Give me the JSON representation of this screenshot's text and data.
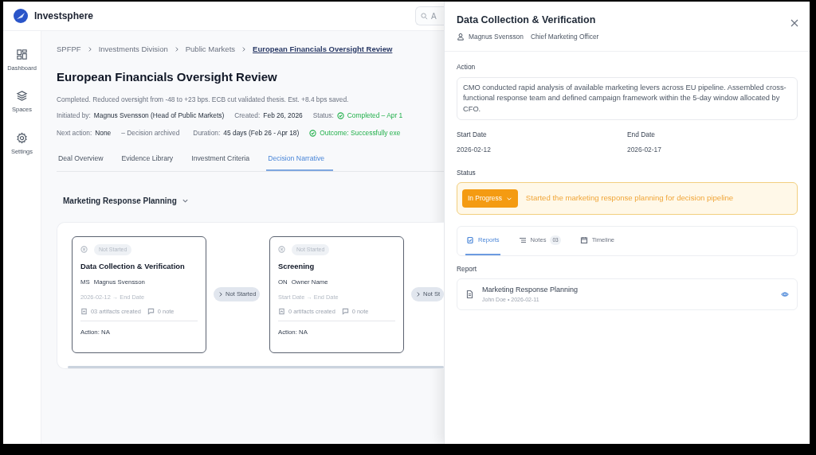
{
  "app": {
    "name": "Investsphere",
    "search_placeholder": "A"
  },
  "sidebar": {
    "items": [
      {
        "label": "Dashboard"
      },
      {
        "label": "Spaces"
      },
      {
        "label": "Settings"
      }
    ]
  },
  "breadcrumb": [
    {
      "label": "SPFPF",
      "current": false
    },
    {
      "label": "Investments Division",
      "current": false
    },
    {
      "label": "Public Markets",
      "current": false
    },
    {
      "label": "European Financials Oversight Review",
      "current": true
    }
  ],
  "page": {
    "title": "European Financials Oversight Review",
    "summary": "Completed. Reduced oversight from -48 to +23 bps. ECB cut validated thesis. Est. +8.4 bps saved.",
    "meta_rows": [
      [
        {
          "kind": "field",
          "label": "Initiated by:",
          "value": "Magnus Svensson (Head of Public Markets)"
        },
        {
          "kind": "field",
          "label": "Created:",
          "value": "Feb 26, 2026"
        },
        {
          "kind": "status",
          "label": "Status:",
          "value": "Completed – Apr 1"
        }
      ],
      [
        {
          "kind": "field",
          "label": "Next action:",
          "value": "None"
        },
        {
          "kind": "note",
          "value": "–  Decision archived"
        },
        {
          "kind": "field",
          "label": "Duration:",
          "value": "45 days (Feb 26 - Apr 18)"
        },
        {
          "kind": "status",
          "value": "Outcome: Successfully exe"
        }
      ]
    ]
  },
  "tabs": [
    {
      "label": "Deal Overview",
      "selected": false
    },
    {
      "label": "Evidence Library",
      "selected": false
    },
    {
      "label": "Investment Criteria",
      "selected": false
    },
    {
      "label": "Decision Narrative",
      "selected": true
    }
  ],
  "workflow": {
    "label": "Marketing Response Planning",
    "stages": [
      {
        "status": "Not Started",
        "title": "Data Collection & Verification",
        "initials": "MS",
        "owner": "Magnus Svensson",
        "dates": "2026-02-12 → End Date",
        "artifacts": "03 artifacts created",
        "notes": "0 note",
        "action_label": "Action:",
        "action": "NA",
        "connector": "Not Started"
      },
      {
        "status": "Not Started",
        "title": "Screening",
        "initials": "ON",
        "owner": "Owner Name",
        "dates": "Start Date → End Date",
        "artifacts": "0 artifacts created",
        "notes": "0 note",
        "action_label": "Action:",
        "action": "NA",
        "connector": "Not St"
      }
    ]
  },
  "drawer": {
    "title": "Data Collection & Verification",
    "person": "Magnus Svensson",
    "role": "Chief Marketing Officer",
    "action_label": "Action",
    "action_text": "CMO conducted rapid analysis of available marketing levers across EU pipeline. Assembled cross-functional response team and defined campaign framework within the 5-day window allocated by CFO.",
    "start_label": "Start Date",
    "start": "2026-02-12",
    "end_label": "End Date",
    "end": "2026-02-17",
    "status_label": "Status",
    "status": {
      "kind": "in_progress",
      "label": "In Progress",
      "message": "Started the marketing response planning for decision pipeline"
    },
    "tabs": [
      {
        "label": "Reports",
        "selected": true
      },
      {
        "label": "Notes",
        "badge": "03",
        "selected": false
      },
      {
        "label": "Timeline",
        "selected": false
      }
    ],
    "report_label": "Report",
    "reports": [
      {
        "title": "Marketing Response Planning",
        "meta": "John Doe • 2026-02-11"
      }
    ]
  }
}
